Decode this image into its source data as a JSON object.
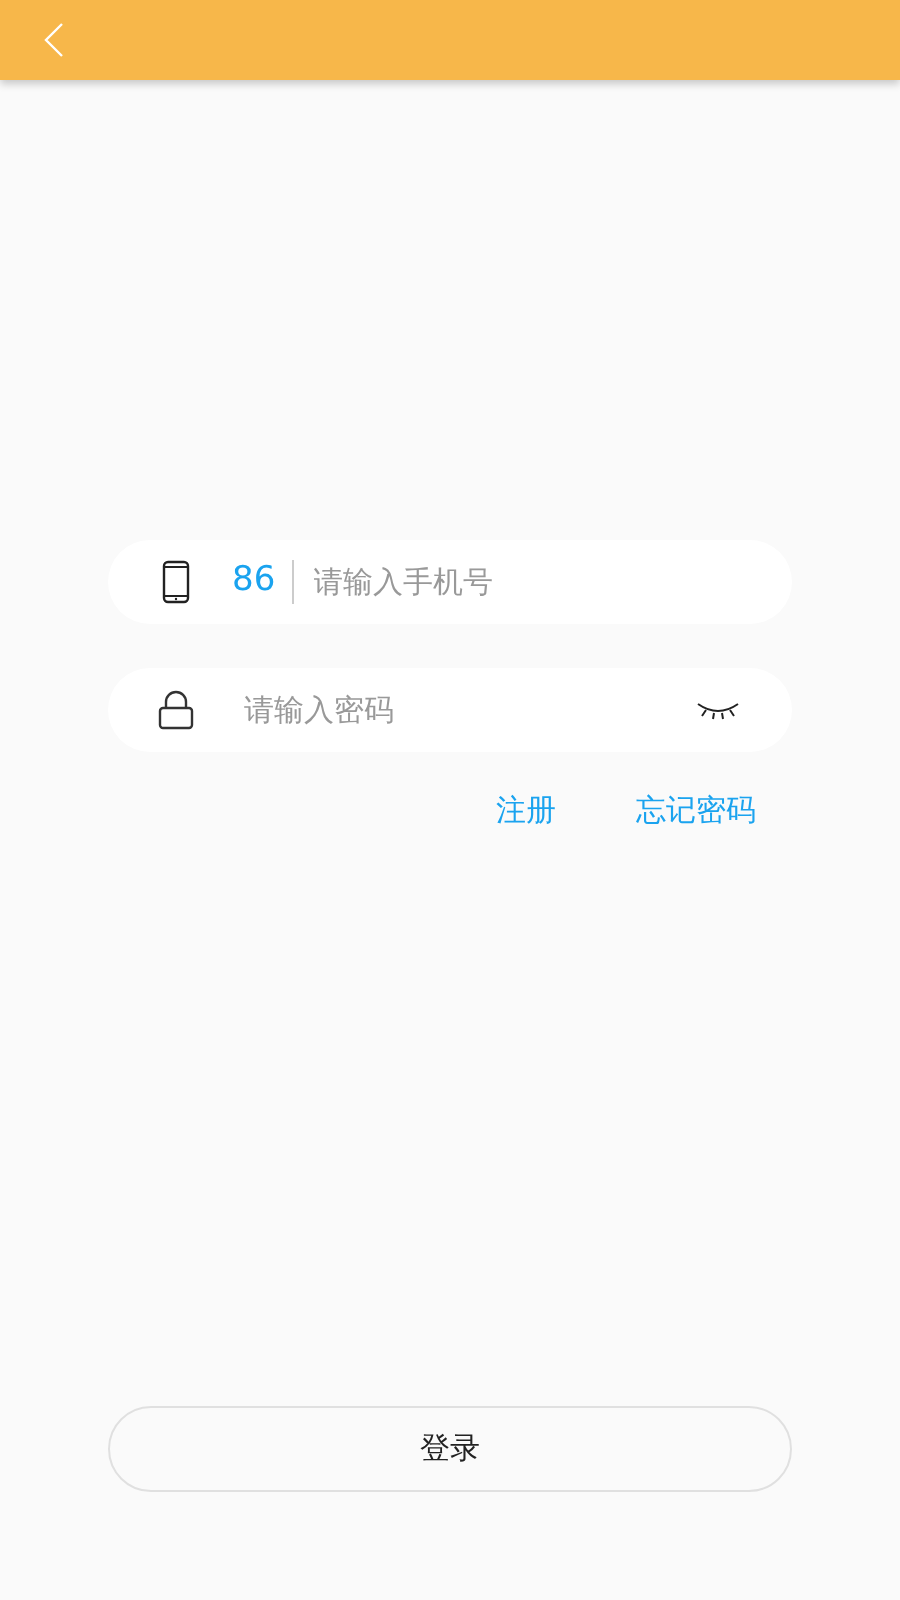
{
  "phone_field": {
    "country_code": "86",
    "placeholder": "请输入手机号"
  },
  "password_field": {
    "placeholder": "请输入密码"
  },
  "links": [
    "注册",
    "忘记密码"
  ],
  "login_button": "登录"
}
